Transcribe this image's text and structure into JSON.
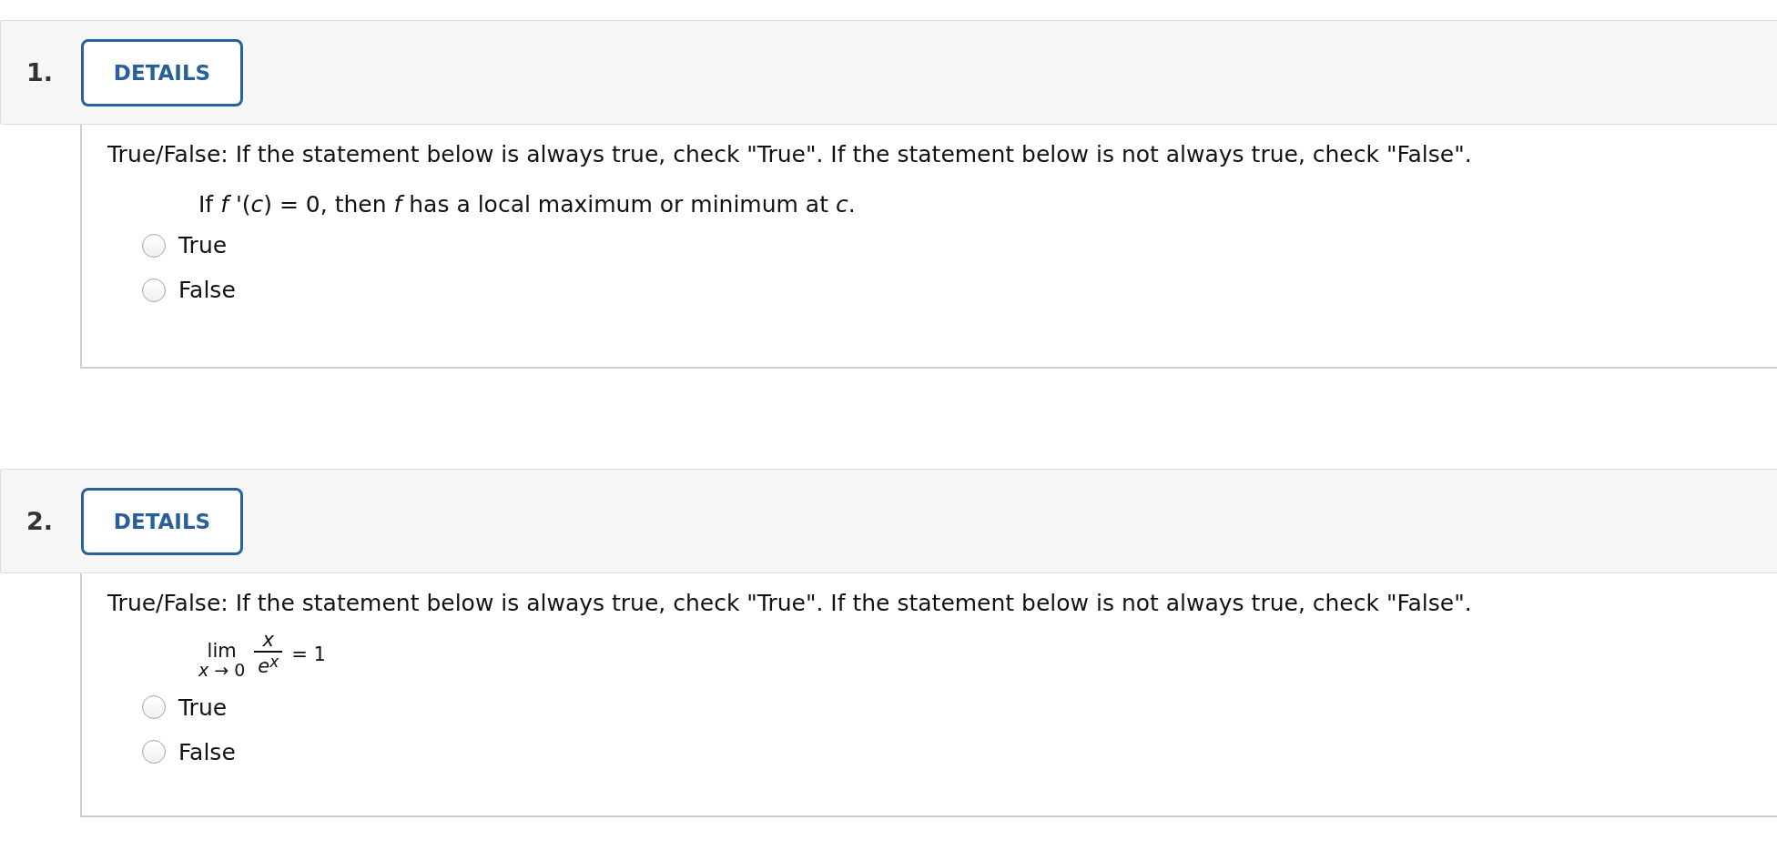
{
  "questions": [
    {
      "number": "1.",
      "details_button": "DETAILS",
      "prompt": "True/False: If the statement below is always true, check \"True\". If the statement below is not always true, check \"False\".",
      "statement": {
        "kind": "text",
        "text": "If *f* '(*c*) = 0, then *f* has a local maximum or minimum at *c*."
      },
      "options": [
        {
          "label": "True",
          "selected": false
        },
        {
          "label": "False",
          "selected": false
        }
      ]
    },
    {
      "number": "2.",
      "details_button": "DETAILS",
      "prompt": "True/False: If the statement below is always true, check \"True\". If the statement below is not always true, check \"False\".",
      "statement": {
        "kind": "limit",
        "lim": "lim",
        "subscript": "*x* → 0",
        "numerator": "x",
        "denominator": "e$^{x}$",
        "rhs": "= 1"
      },
      "options": [
        {
          "label": "True",
          "selected": false
        },
        {
          "label": "False",
          "selected": false
        }
      ]
    }
  ]
}
